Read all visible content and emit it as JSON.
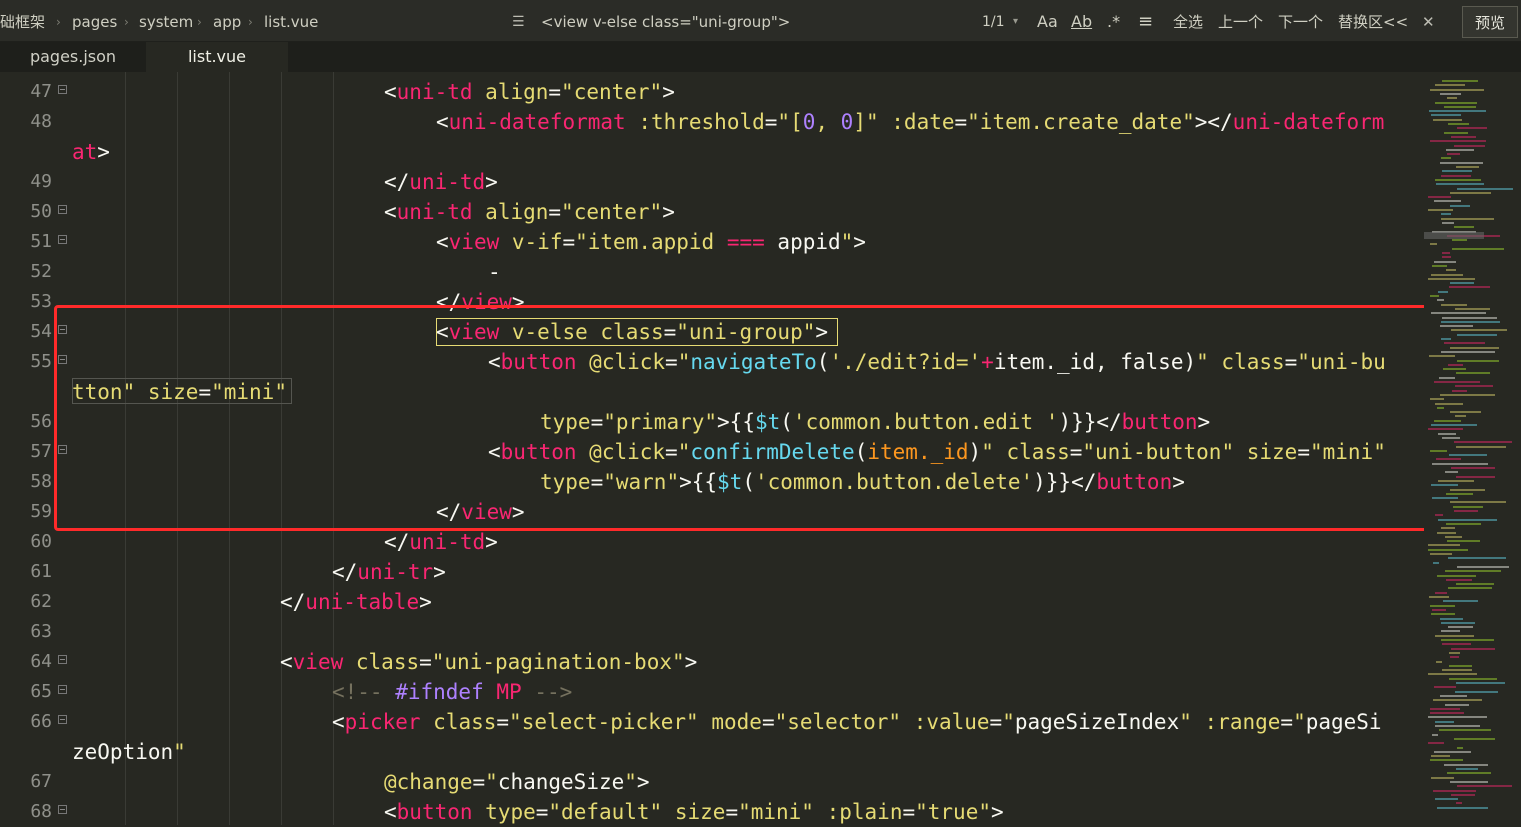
{
  "breadcrumb": {
    "items": [
      "础框架",
      "pages",
      "system",
      "app",
      "list.vue"
    ]
  },
  "search": {
    "value": "<view v-else class=\"uni-group\">",
    "match_count": "1/1"
  },
  "toolbar": {
    "case_label": "Aa",
    "word_label": "Ab",
    "regex_label": ".*",
    "select_all": "全选",
    "prev": "上一个",
    "next": "下一个",
    "replace": "替换区<<",
    "close": "✕",
    "preview": "预览"
  },
  "tabs": [
    {
      "label": "pages.json"
    },
    {
      "label": "list.vue"
    }
  ],
  "lines": [
    {
      "num": "47",
      "fold": true,
      "text": "<uni-td align=\"center\">"
    },
    {
      "num": "48",
      "fold": false,
      "text": "<uni-dateformat :threshold=\"[0, 0]\" :date=\"item.create_date\"></uni-dateform"
    },
    {
      "num": "",
      "fold": false,
      "text": "at>"
    },
    {
      "num": "49",
      "fold": false,
      "text": "</uni-td>"
    },
    {
      "num": "50",
      "fold": true,
      "text": "<uni-td align=\"center\">"
    },
    {
      "num": "51",
      "fold": true,
      "text": "<view v-if=\"item.appid === appid\">"
    },
    {
      "num": "52",
      "fold": false,
      "text": "-"
    },
    {
      "num": "53",
      "fold": false,
      "text": "</view>"
    },
    {
      "num": "54",
      "fold": true,
      "text": "<view v-else class=\"uni-group\">"
    },
    {
      "num": "55",
      "fold": true,
      "text": "<button @click=\"navigateTo('./edit?id='+item._id, false)\" class=\"uni-bu"
    },
    {
      "num": "",
      "fold": false,
      "text": "tton\" size=\"mini\""
    },
    {
      "num": "56",
      "fold": false,
      "text": "type=\"primary\">{{$t('common.button.edit ')}}</button>"
    },
    {
      "num": "57",
      "fold": true,
      "text": "<button @click=\"confirmDelete(item._id)\" class=\"uni-button\" size=\"mini\""
    },
    {
      "num": "58",
      "fold": false,
      "text": "type=\"warn\">{{$t('common.button.delete')}}</button>"
    },
    {
      "num": "59",
      "fold": false,
      "text": "</view>"
    },
    {
      "num": "60",
      "fold": false,
      "text": "</uni-td>"
    },
    {
      "num": "61",
      "fold": false,
      "text": "</uni-tr>"
    },
    {
      "num": "62",
      "fold": false,
      "text": "</uni-table>"
    },
    {
      "num": "63",
      "fold": false,
      "text": ""
    },
    {
      "num": "64",
      "fold": true,
      "text": "<view class=\"uni-pagination-box\">"
    },
    {
      "num": "65",
      "fold": true,
      "text": "<!-- #ifndef MP -->"
    },
    {
      "num": "66",
      "fold": true,
      "text": "<picker class=\"select-picker\" mode=\"selector\" :value=\"pageSizeIndex\" :range=\"pageSi"
    },
    {
      "num": "",
      "fold": false,
      "text": "zeOption\""
    },
    {
      "num": "67",
      "fold": false,
      "text": "@change=\"changeSize\">"
    },
    {
      "num": "68",
      "fold": true,
      "text": "<button type=\"default\" size=\"mini\" :plain=\"true\">"
    }
  ]
}
